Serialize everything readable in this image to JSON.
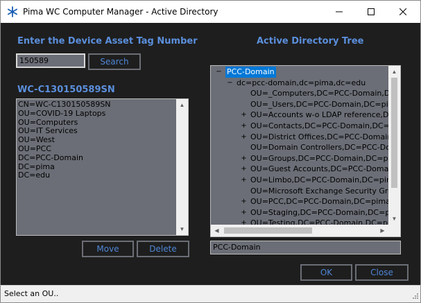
{
  "window": {
    "title": "Pima WC Computer Manager - Active Directory",
    "icon": "snowflake-icon"
  },
  "asset_section": {
    "heading": "Enter the Device Asset Tag Number",
    "asset_tag_value": "150589",
    "search_label": "Search"
  },
  "computer": {
    "heading": "WC-C130150589SN",
    "dn_parts": [
      "CN=WC-C130150589SN",
      "OU=COVID-19 Laptops",
      "OU=Computers",
      "OU=IT Services",
      "OU=West",
      "OU=PCC",
      "DC=PCC-Domain",
      "DC=pima",
      "DC=edu"
    ],
    "move_label": "Move",
    "delete_label": "Delete"
  },
  "tree": {
    "heading": "Active Directory Tree",
    "nodes": [
      {
        "text": "PCC-Domain",
        "expander": "−",
        "level": 0,
        "selected": true
      },
      {
        "text": "dc=pcc-domain,dc=pima,dc=edu",
        "expander": "−",
        "level": 1,
        "selected": false
      },
      {
        "text": "OU=_Computers,DC=PCC-Domain,DC=pima",
        "expander": "",
        "level": 2,
        "selected": false
      },
      {
        "text": "OU=_Users,DC=PCC-Domain,DC=pima,DC",
        "expander": "",
        "level": 2,
        "selected": false
      },
      {
        "text": "OU=Accounts w-o LDAP reference,DC=PCC",
        "expander": "+",
        "level": 2,
        "selected": false
      },
      {
        "text": "OU=Contacts,DC=PCC-Domain,DC=pima,D",
        "expander": "+",
        "level": 2,
        "selected": false
      },
      {
        "text": "OU=District Offices,DC=PCC-Domain,DC=p",
        "expander": "+",
        "level": 2,
        "selected": false
      },
      {
        "text": "OU=Domain Controllers,DC=PCC-Domain,D",
        "expander": "",
        "level": 2,
        "selected": false
      },
      {
        "text": "OU=Groups,DC=PCC-Domain,DC=pima,DC",
        "expander": "+",
        "level": 2,
        "selected": false
      },
      {
        "text": "OU=Guest Accounts,DC=PCC-Domain,DC=p",
        "expander": "+",
        "level": 2,
        "selected": false
      },
      {
        "text": "OU=Limbo,DC=PCC-Domain,DC=pima,DC=",
        "expander": "+",
        "level": 2,
        "selected": false
      },
      {
        "text": "OU=Microsoft Exchange Security Groups,D",
        "expander": "",
        "level": 2,
        "selected": false
      },
      {
        "text": "OU=PCC,DC=PCC-Domain,DC=pima,DC=ed",
        "expander": "+",
        "level": 2,
        "selected": false
      },
      {
        "text": "OU=Staging,DC=PCC-Domain,DC=pima,DC",
        "expander": "+",
        "level": 2,
        "selected": false
      },
      {
        "text": "OU=Testing,DC=PCC-Domain,DC=pima,DC",
        "expander": "+",
        "level": 2,
        "selected": false
      }
    ],
    "selected_path": "PCC-Domain"
  },
  "footer": {
    "ok_label": "OK",
    "close_label": "Close"
  },
  "status": {
    "text": "Select an OU.."
  },
  "colors": {
    "heading_blue": "#5b8fdc",
    "button_text_blue": "#4f86d6",
    "panel_gray": "#6b6e76",
    "background": "#1e1e1e",
    "selection_blue": "#0078d7"
  }
}
